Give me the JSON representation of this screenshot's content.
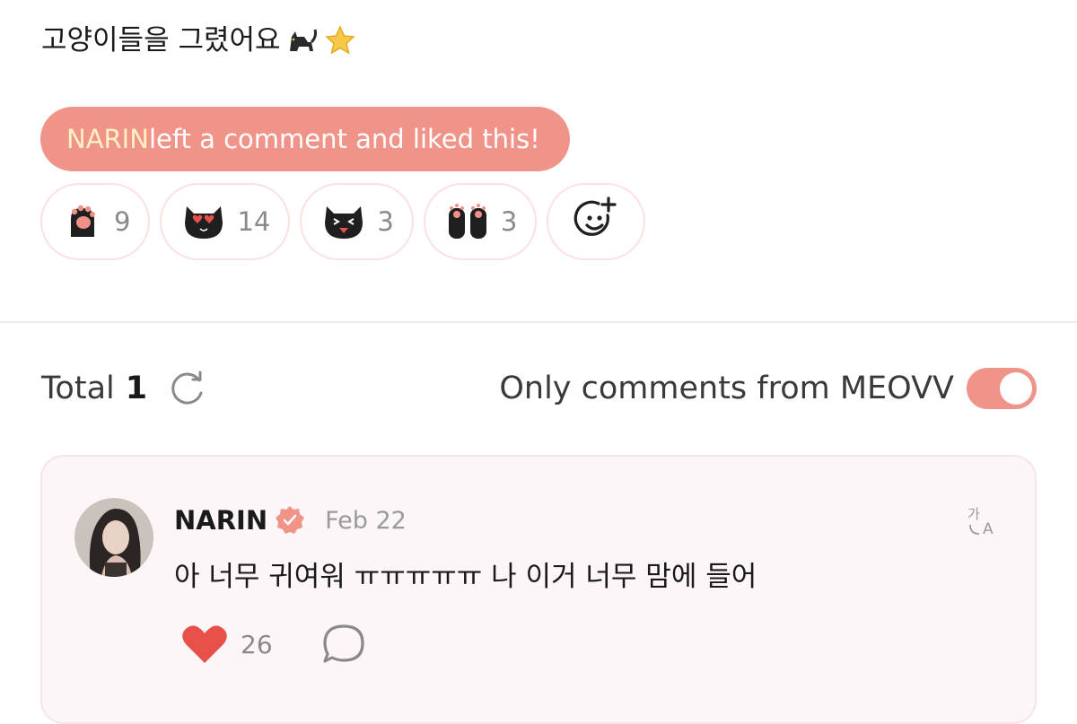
{
  "post": {
    "text": "고양이들을 그렸어요",
    "emojis": [
      "black-cat-emoji",
      "star-emoji"
    ]
  },
  "notice": {
    "nickname": "NARIN",
    "message": "left a comment and liked this!"
  },
  "reactions": [
    {
      "icon": "cat-paw-icon",
      "count": "9"
    },
    {
      "icon": "heart-eyes-cat-icon",
      "count": "14"
    },
    {
      "icon": "squint-cat-icon",
      "count": "3"
    },
    {
      "icon": "cat-paws-icon",
      "count": "3"
    }
  ],
  "comments_header": {
    "total_label": "Total",
    "total_count": "1",
    "filter_label": "Only comments from MEOVV",
    "filter_on": true
  },
  "comment": {
    "author": "NARIN",
    "date": "Feb 22",
    "text": "아 너무 귀여워 ㅠㅠㅠㅠㅠ 나 이거 너무 맘에 들어",
    "likes": "26"
  },
  "colors": {
    "accent": "#f0948a",
    "heart": "#e8514a",
    "card_bg": "#fdf6f8"
  }
}
